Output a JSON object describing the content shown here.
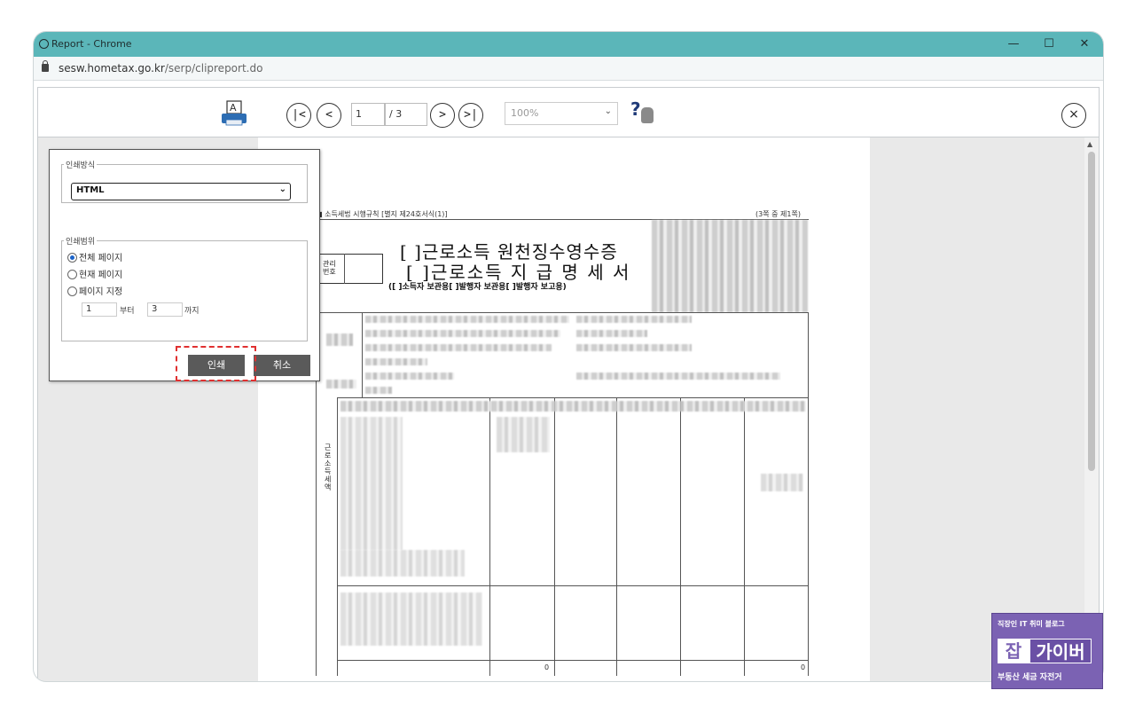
{
  "window": {
    "title": "Report - Chrome",
    "url_host": "sesw.hometax.go.kr",
    "url_path": "/serp/clipreport.do"
  },
  "toolbar": {
    "first_icon": "first-page-icon",
    "prev_icon": "prev-page-icon",
    "next_icon": "next-page-icon",
    "last_icon": "last-page-icon",
    "first_label": "|<",
    "prev_label": "<",
    "next_label": ">",
    "last_label": ">|",
    "page_value": "1",
    "page_total": "/ 3",
    "zoom_value": "100%",
    "close_label": "×",
    "help_label": "?"
  },
  "print_dialog": {
    "method_legend": "인쇄방식",
    "method_value": "HTML",
    "range_legend": "인쇄범위",
    "options": [
      "전체 페이지",
      "현재 페이지",
      "페이지 지정"
    ],
    "selected_option": 0,
    "from_value": "1",
    "from_label": "부터",
    "to_value": "3",
    "to_label": "까지",
    "print_button": "인쇄",
    "cancel_button": "취소"
  },
  "document": {
    "top_note": "■ 소득세법 시행규칙 [별지 제24호서식(1)]",
    "page_note": "(3쪽 중 제1쪽)",
    "title_line1": "[ ]근로소득 원천징수영수증",
    "title_line2": "[ ]근로소득 지 급 명 세 서",
    "title_line3": "([    ]소득자 보관용[    ]발행자 보관용[    ]발행자 보고용)",
    "manage_no": "관리\n번호",
    "side_label": "근로소득세액"
  },
  "watermark": {
    "top": "직장인 IT 취미 블로그",
    "char1": "잡",
    "word": "가이버",
    "bottom": "부동산 세금 자전거"
  }
}
